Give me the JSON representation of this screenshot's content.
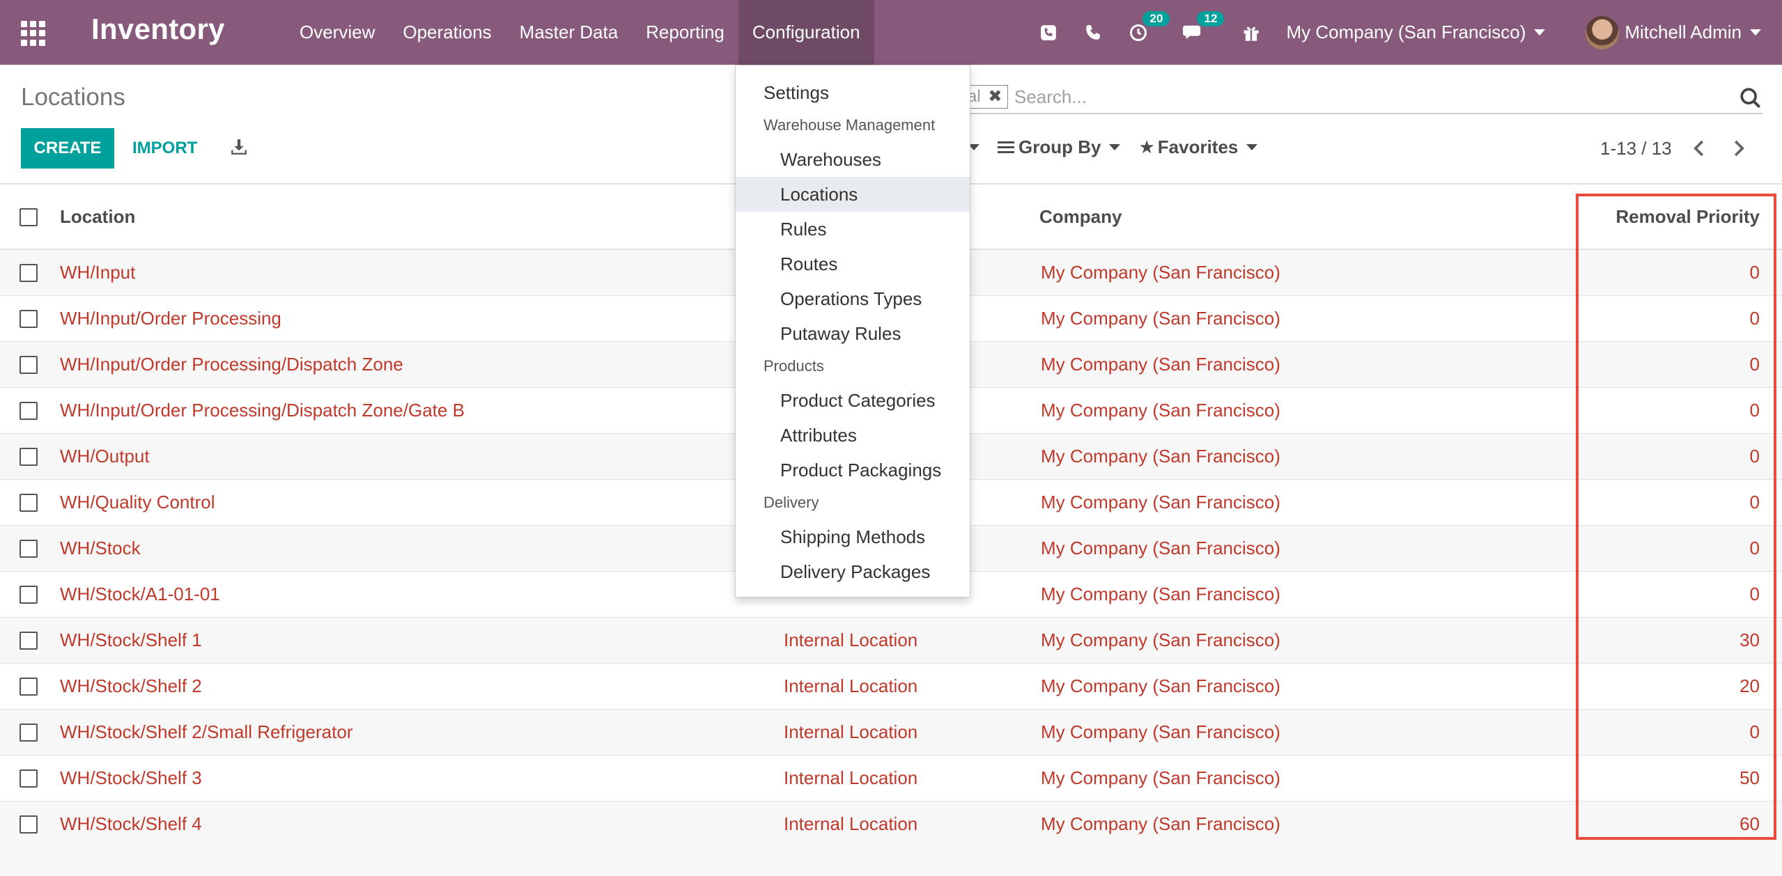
{
  "app": {
    "brand": "Inventory",
    "menu": [
      "Overview",
      "Operations",
      "Master Data",
      "Reporting",
      "Configuration"
    ],
    "active_menu": "Configuration",
    "activity_badge": "20",
    "messages_badge": "12",
    "company": "My Company (San Francisco)",
    "user": "Mitchell Admin",
    "accent_color": "#875a7b"
  },
  "control": {
    "breadcrumb": "Locations",
    "create_label": "CREATE",
    "import_label": "IMPORT",
    "facet_text": "al",
    "search_placeholder": "Search...",
    "group_by_label": "Group By",
    "favorites_label": "Favorites",
    "pager": "1-13 / 13"
  },
  "table": {
    "headers": {
      "location": "Location",
      "company": "Company",
      "removal_priority": "Removal Priority"
    },
    "rows": [
      {
        "location": "WH/Input",
        "type": "",
        "company": "My Company (San Francisco)",
        "priority": "0"
      },
      {
        "location": "WH/Input/Order Processing",
        "type": "",
        "company": "My Company (San Francisco)",
        "priority": "0"
      },
      {
        "location": "WH/Input/Order Processing/Dispatch Zone",
        "type": "",
        "company": "My Company (San Francisco)",
        "priority": "0"
      },
      {
        "location": "WH/Input/Order Processing/Dispatch Zone/Gate B",
        "type": "",
        "company": "My Company (San Francisco)",
        "priority": "0"
      },
      {
        "location": "WH/Output",
        "type": "",
        "company": "My Company (San Francisco)",
        "priority": "0"
      },
      {
        "location": "WH/Quality Control",
        "type": "",
        "company": "My Company (San Francisco)",
        "priority": "0"
      },
      {
        "location": "WH/Stock",
        "type": "",
        "company": "My Company (San Francisco)",
        "priority": "0"
      },
      {
        "location": "WH/Stock/A1-01-01",
        "type": "",
        "company": "My Company (San Francisco)",
        "priority": "0"
      },
      {
        "location": "WH/Stock/Shelf 1",
        "type": "Internal Location",
        "company": "My Company (San Francisco)",
        "priority": "30"
      },
      {
        "location": "WH/Stock/Shelf 2",
        "type": "Internal Location",
        "company": "My Company (San Francisco)",
        "priority": "20"
      },
      {
        "location": "WH/Stock/Shelf 2/Small Refrigerator",
        "type": "Internal Location",
        "company": "My Company (San Francisco)",
        "priority": "0"
      },
      {
        "location": "WH/Stock/Shelf 3",
        "type": "Internal Location",
        "company": "My Company (San Francisco)",
        "priority": "50"
      },
      {
        "location": "WH/Stock/Shelf 4",
        "type": "Internal Location",
        "company": "My Company (San Francisco)",
        "priority": "60"
      }
    ]
  },
  "dropdown": {
    "settings": "Settings",
    "warehouse_header": "Warehouse Management",
    "warehouses": "Warehouses",
    "locations": "Locations",
    "rules": "Rules",
    "routes": "Routes",
    "operations_types": "Operations Types",
    "putaway_rules": "Putaway Rules",
    "products_header": "Products",
    "product_categories": "Product Categories",
    "attributes": "Attributes",
    "product_packagings": "Product Packagings",
    "delivery_header": "Delivery",
    "shipping_methods": "Shipping Methods",
    "delivery_packages": "Delivery Packages"
  }
}
